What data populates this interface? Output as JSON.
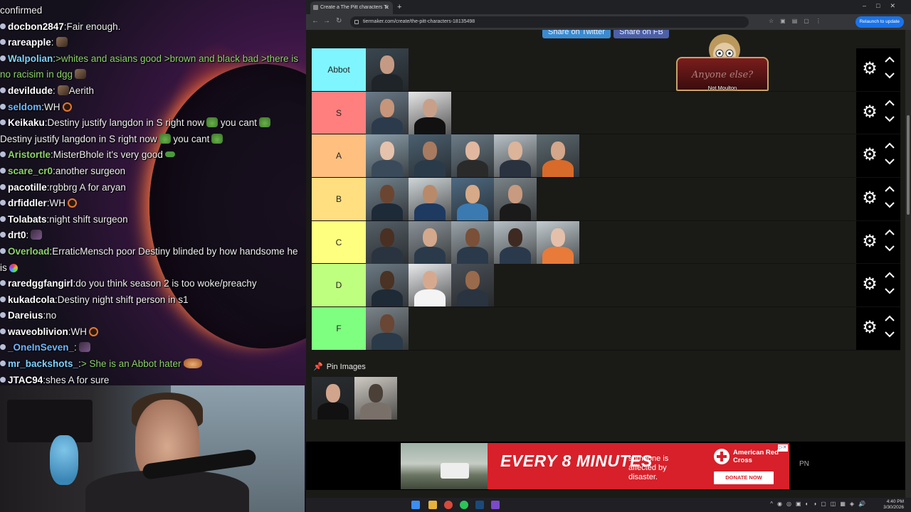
{
  "chat": {
    "messages": [
      {
        "user": "",
        "text": "confirmed",
        "color": "#ffffff",
        "emote": ""
      },
      {
        "user": "docbon2847",
        "text": "Fair enough.",
        "color": "#ffffff",
        "emote": ""
      },
      {
        "user": "rareapple",
        "text": "",
        "color": "#ffffff",
        "emote": "face"
      },
      {
        "user": "Walpolian",
        "text": ">whites and asians good >brown and black bad >there is no racisim in dgg",
        "color": "#7dd3ff",
        "textcolor": "#8ed36c",
        "emote": "face"
      },
      {
        "user": "devildude",
        "text": "Aerith",
        "color": "#ffffff",
        "emote": "face",
        "emote_before": true
      },
      {
        "user": "seldom",
        "text": "WH",
        "color": "#6fb7ff",
        "emote": "ring"
      },
      {
        "user": "Keikaku",
        "text": "Destiny justify langdon in S right now",
        "color": "#ffffff",
        "emote": "pepe",
        "extra": "you cant",
        "repeat": "Destiny justify langdon in S right now"
      },
      {
        "user": "Aristortle",
        "text": "MisterBhole it's very good",
        "color": "#8ed36c",
        "emote": "small-green"
      },
      {
        "user": "scare_cr0",
        "text": "another surgeon",
        "color": "#8ed36c",
        "emote": ""
      },
      {
        "user": "pacotille",
        "text": "rgbbrg A for aryan",
        "color": "#ffffff",
        "emote": ""
      },
      {
        "user": "drfiddler",
        "text": "WH",
        "color": "#ffffff",
        "emote": "ring"
      },
      {
        "user": "Tolabats",
        "text": "night shift surgeon",
        "color": "#ffffff",
        "emote": ""
      },
      {
        "user": "drt0",
        "text": "",
        "color": "#ffffff",
        "emote": "dark"
      },
      {
        "user": "Overload",
        "text": "ErraticMensch poor Destiny blinded by how handsome he is",
        "color": "#8ed36c",
        "emote": "rainbow"
      },
      {
        "user": "raredggfangirl",
        "text": "do you think season 2 is too woke/preachy",
        "color": "#ffffff",
        "emote": ""
      },
      {
        "user": "kukadcola",
        "text": "Destiny night shift person in s1",
        "color": "#ffffff",
        "emote": ""
      },
      {
        "user": "Dareius",
        "text": "no",
        "color": "#ffffff",
        "emote": ""
      },
      {
        "user": "waveoblivion",
        "text": "WH",
        "color": "#ffffff",
        "emote": "ring"
      },
      {
        "user": "_OneInSeven_",
        "text": "",
        "color": "#6fb7ff",
        "emote": "dark"
      },
      {
        "user": "mr_backshots_",
        "text": "> She is an Abbot hater",
        "color": "#7dd3ff",
        "textcolor": "#8ed36c",
        "emote": "food"
      },
      {
        "user": "JTAC94",
        "text": "shes A for sure",
        "color": "#ffffff",
        "emote": ""
      }
    ]
  },
  "browser": {
    "tab_title": "Create a The Pitt characters Ti",
    "url": "tiermaker.com/create/the-pitt-characters-18135498",
    "relaunch": "Relaunch to update",
    "share_twitter": "Share on Twitter",
    "share_fb": "Share on FB"
  },
  "overlay": {
    "podium_text": "Anyone else?",
    "caption": "Not Moulton"
  },
  "tiers": [
    {
      "label": "Abbot",
      "color": "#7ff6ff",
      "items": [
        {
          "bg": "#3a4750",
          "skin": "#c59a84",
          "shirt": "#1e2428"
        }
      ]
    },
    {
      "label": "S",
      "color": "#ff7f7f",
      "items": [
        {
          "bg": "#6a7a88",
          "skin": "#c6957a",
          "shirt": "#2b3b4c"
        },
        {
          "bg": "#e6e6e6",
          "skin": "#c8a08a",
          "shirt": "#111"
        }
      ]
    },
    {
      "label": "A",
      "color": "#ffbf7f",
      "items": [
        {
          "bg": "#8ca0ac",
          "skin": "#e5c2ab",
          "shirt": "#3a4a5a"
        },
        {
          "bg": "#4b6070",
          "skin": "#a87a60",
          "shirt": "#2a3a48"
        },
        {
          "bg": "#6c7c88",
          "skin": "#e1b89f",
          "shirt": "#2a2a2a"
        },
        {
          "bg": "#b8c2c8",
          "skin": "#dbb49a",
          "shirt": "#2a3240"
        },
        {
          "bg": "#5c6a70",
          "skin": "#d4a68a",
          "shirt": "#d86a2a"
        }
      ]
    },
    {
      "label": "B",
      "color": "#ffdf7f",
      "items": [
        {
          "bg": "#72828c",
          "skin": "#6a4632",
          "shirt": "#1d2a38"
        },
        {
          "bg": "#cfd6d8",
          "skin": "#b88a6a",
          "shirt": "#1e3a60"
        },
        {
          "bg": "#4e6a82",
          "skin": "#d6a988",
          "shirt": "#3a7ab0"
        },
        {
          "bg": "#7a8488",
          "skin": "#c89a80",
          "shirt": "#1a1a1a"
        }
      ]
    },
    {
      "label": "C",
      "color": "#ffff7f",
      "items": [
        {
          "bg": "#556068",
          "skin": "#4a3022",
          "shirt": "#2a3440"
        },
        {
          "bg": "#8a9298",
          "skin": "#d4a88c",
          "shirt": "#2a3a4a"
        },
        {
          "bg": "#9aa4aa",
          "skin": "#7a5038",
          "shirt": "#2a3a4a"
        },
        {
          "bg": "#b6c0c6",
          "skin": "#3e2a20",
          "shirt": "#2a3a4c"
        },
        {
          "bg": "#c2ccd0",
          "skin": "#e4c0aa",
          "shirt": "#e87a3a"
        }
      ]
    },
    {
      "label": "D",
      "color": "#bfff7f",
      "items": [
        {
          "bg": "#6c7a84",
          "skin": "#4a3224",
          "shirt": "#1e2a36"
        },
        {
          "bg": "#e8eaec",
          "skin": "#d6a98e",
          "shirt": "#f4f4f4"
        },
        {
          "bg": "#4a5058",
          "skin": "#9a6a4c",
          "shirt": "#2a3440"
        }
      ]
    },
    {
      "label": "F",
      "color": "#7fff7f",
      "items": [
        {
          "bg": "#7a848a",
          "skin": "#6a4634",
          "shirt": "#2a3a48"
        }
      ]
    }
  ],
  "pin_images": {
    "label": "Pin Images",
    "items": [
      {
        "bg": "#2a2e32",
        "skin": "#d1a58c",
        "shirt": "#111"
      },
      {
        "bg": "#cfcbc4",
        "skin": "#4a4038",
        "shirt": "#7a706a"
      }
    ]
  },
  "ad": {
    "headline": "EVERY 8 MINUTES",
    "sub": "someone is affected by disaster.",
    "brand": "American Red Cross",
    "button": "DONATE NOW",
    "side": "PN"
  },
  "taskbar": {
    "time": "4:40 PM",
    "date": "3/30/2026"
  }
}
